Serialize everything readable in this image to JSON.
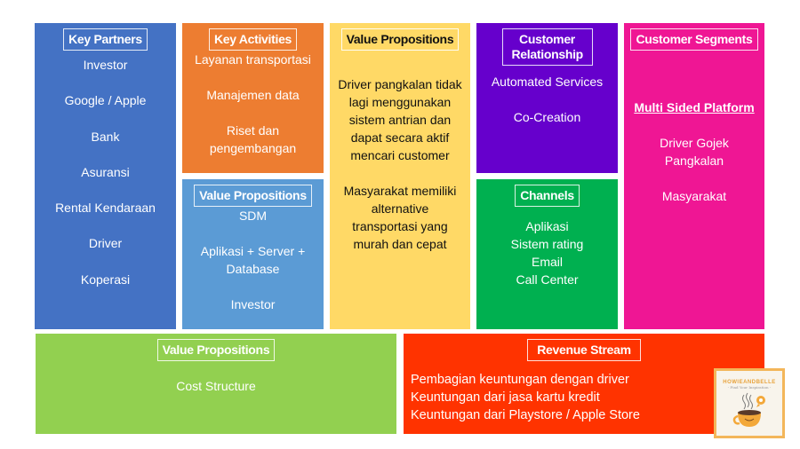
{
  "canvas": {
    "key_partners": {
      "title": "Key Partners",
      "color": "#4472c4",
      "items": [
        "Investor",
        "Google / Apple",
        "Bank",
        "Asuransi",
        "Rental Kendaraan",
        "Driver",
        "Koperasi"
      ]
    },
    "key_activities": {
      "title": "Key Activities",
      "color": "#ed7d31",
      "items": [
        "Layanan transportasi",
        "Manajemen data",
        "Riset dan pengembangan"
      ]
    },
    "key_resources": {
      "title": "Value Propositions",
      "color": "#5b9bd5",
      "items": [
        "SDM",
        "Aplikasi + Server + Database",
        "Investor"
      ]
    },
    "value_propositions": {
      "title": "Value Propositions",
      "color": "#ffd966",
      "items": [
        "Driver pangkalan tidak lagi menggunakan sistem antrian dan dapat secara aktif mencari customer",
        "Masyarakat memiliki alternative transportasi yang murah dan cepat"
      ]
    },
    "customer_relationship": {
      "title": "Customer Relationship",
      "color": "#6600cc",
      "items": [
        "Automated Services",
        "Co-Creation"
      ]
    },
    "channels": {
      "title": "Channels",
      "color": "#00b050",
      "items": [
        "Aplikasi",
        "Sistem rating",
        "Email",
        "Call Center"
      ]
    },
    "customer_segments": {
      "title": "Customer Segments",
      "color": "#ef1694",
      "subtitle": "Multi Sided Platform",
      "items": [
        "Driver Gojek Pangkalan",
        "Masyarakat"
      ]
    },
    "cost_structure": {
      "title": "Value Propositions",
      "color": "#92d050",
      "items": [
        "Cost Structure"
      ]
    },
    "revenue_stream": {
      "title": "Revenue Stream",
      "color": "#ff3300",
      "items": [
        "Pembagian keuntungan dengan driver",
        "Keuntungan dari jasa kartu kredit",
        "Keuntungan dari Playstore / Apple Store"
      ]
    }
  },
  "logo": {
    "brand": "HOWIEANDBELLE",
    "tagline": "- Find Your Inspiration -",
    "icon": "coffee-cup-icon"
  }
}
